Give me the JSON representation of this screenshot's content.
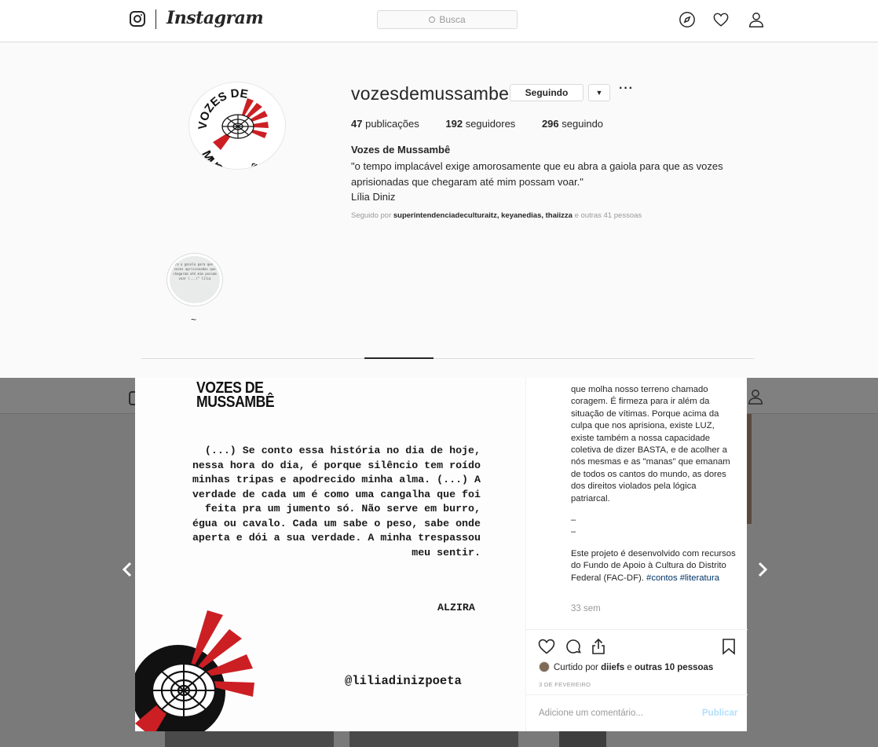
{
  "nav": {
    "wordmark": "Instagram",
    "search_placeholder": "Busca"
  },
  "profile": {
    "username": "vozesdemussambe",
    "follow_button": "Seguindo",
    "dropdown_glyph": "▼",
    "more_glyph": "···",
    "stats": {
      "posts_count": "47",
      "posts_label": "publicações",
      "followers_count": "192",
      "followers_label": "seguidores",
      "following_count": "296",
      "following_label": "seguindo"
    },
    "bio": {
      "name": "Vozes de Mussambê",
      "line1": "\"o tempo implacável exige amorosamente que eu abra a gaiola para que as vozes",
      "line2": "aprisionadas que chegaram até mim possam voar.\"",
      "line3": "Lília Diniz"
    },
    "followed_by": {
      "prefix": "Seguido por",
      "names": "superintendenciadeculturaitz, keyanedias, thaiizza",
      "suffix": "e outras 41 pessoas"
    },
    "highlight": {
      "label": "~",
      "thumb_text": "abra a gaiola para que as vozes aprisionadas que chegaram até mim possam voar (...)\" lília"
    },
    "avatar_text": {
      "top": "VOZES DE",
      "bottom": "MUSSAMBÊ"
    }
  },
  "post": {
    "brand": "VOZES DE\nMUSSAMBÊ",
    "quote": "(...) Se conto essa história no dia de hoje, nessa hora do dia, é porque silêncio tem roído minhas tripas e apodrecido minha alma. (...) A verdade de cada um é como uma cangalha que foi feita pra um jumento só. Não serve em burro, égua ou cavalo. Cada um sabe o peso, sabe onde aperta e dói a sua verdade. A minha trespassou meu sentir.",
    "author": "ALZIRA",
    "handle": "@liliadinizpoeta"
  },
  "sidebar": {
    "caption_p1": "que molha nosso terreno chamado coragem. É firmeza para ir além da situação de vítimas. Porque acima da culpa que nos aprisiona, existe LUZ, existe também a nossa capacidade coletiva de dizer BASTA, e de acolher a nós mesmas e as \"manas\" que emanam de todos os cantos do mundo, as dores dos direitos violados pela lógica patriarcal.",
    "dash1": "–",
    "dash2": "–",
    "caption_p2": "Este projeto é desenvolvido com recursos do Fundo de Apoio à Cultura do Distrito Federal (FAC-DF).",
    "tag1": "#contos",
    "tag2": "#literatura",
    "time_ago": "33 sem",
    "liked_prefix": "Curtido por",
    "liked_user": "diiefs",
    "liked_conj": "e",
    "liked_others": "outras 10 pessoas",
    "date": "3 DE FEVEREIRO",
    "comment_placeholder": "Adicione um comentário...",
    "publish": "Publicar"
  },
  "colors": {
    "emblem_red": "#cc1f24",
    "emblem_black": "#111111",
    "link_blue": "#003569",
    "publish_disabled": "#b2dffc"
  }
}
